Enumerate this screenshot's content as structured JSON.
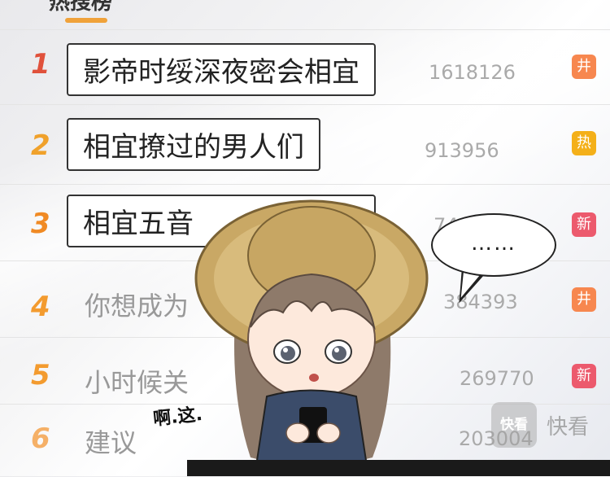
{
  "tab": {
    "label": "热搜榜"
  },
  "rows": [
    {
      "rank": "1",
      "title": "影帝时绥深夜密会相宜",
      "count": "1618126",
      "badge": "井"
    },
    {
      "rank": "2",
      "title": "相宜撩过的男人们",
      "count": "913956",
      "badge": "热"
    },
    {
      "rank": "3",
      "title": "相宜五音",
      "count": "749509",
      "badge": "新"
    },
    {
      "rank": "4",
      "title": "你想成为",
      "count": "384393",
      "badge": "井"
    },
    {
      "rank": "5",
      "title": "小时候关",
      "count": "269770",
      "badge": "新"
    },
    {
      "rank": "6",
      "title": "建议",
      "count": "203004",
      "badge": ""
    }
  ],
  "bubble": {
    "text": "……"
  },
  "sfx": {
    "text": "啊.这."
  },
  "watermark": {
    "logo": "快看",
    "text": "快看"
  }
}
